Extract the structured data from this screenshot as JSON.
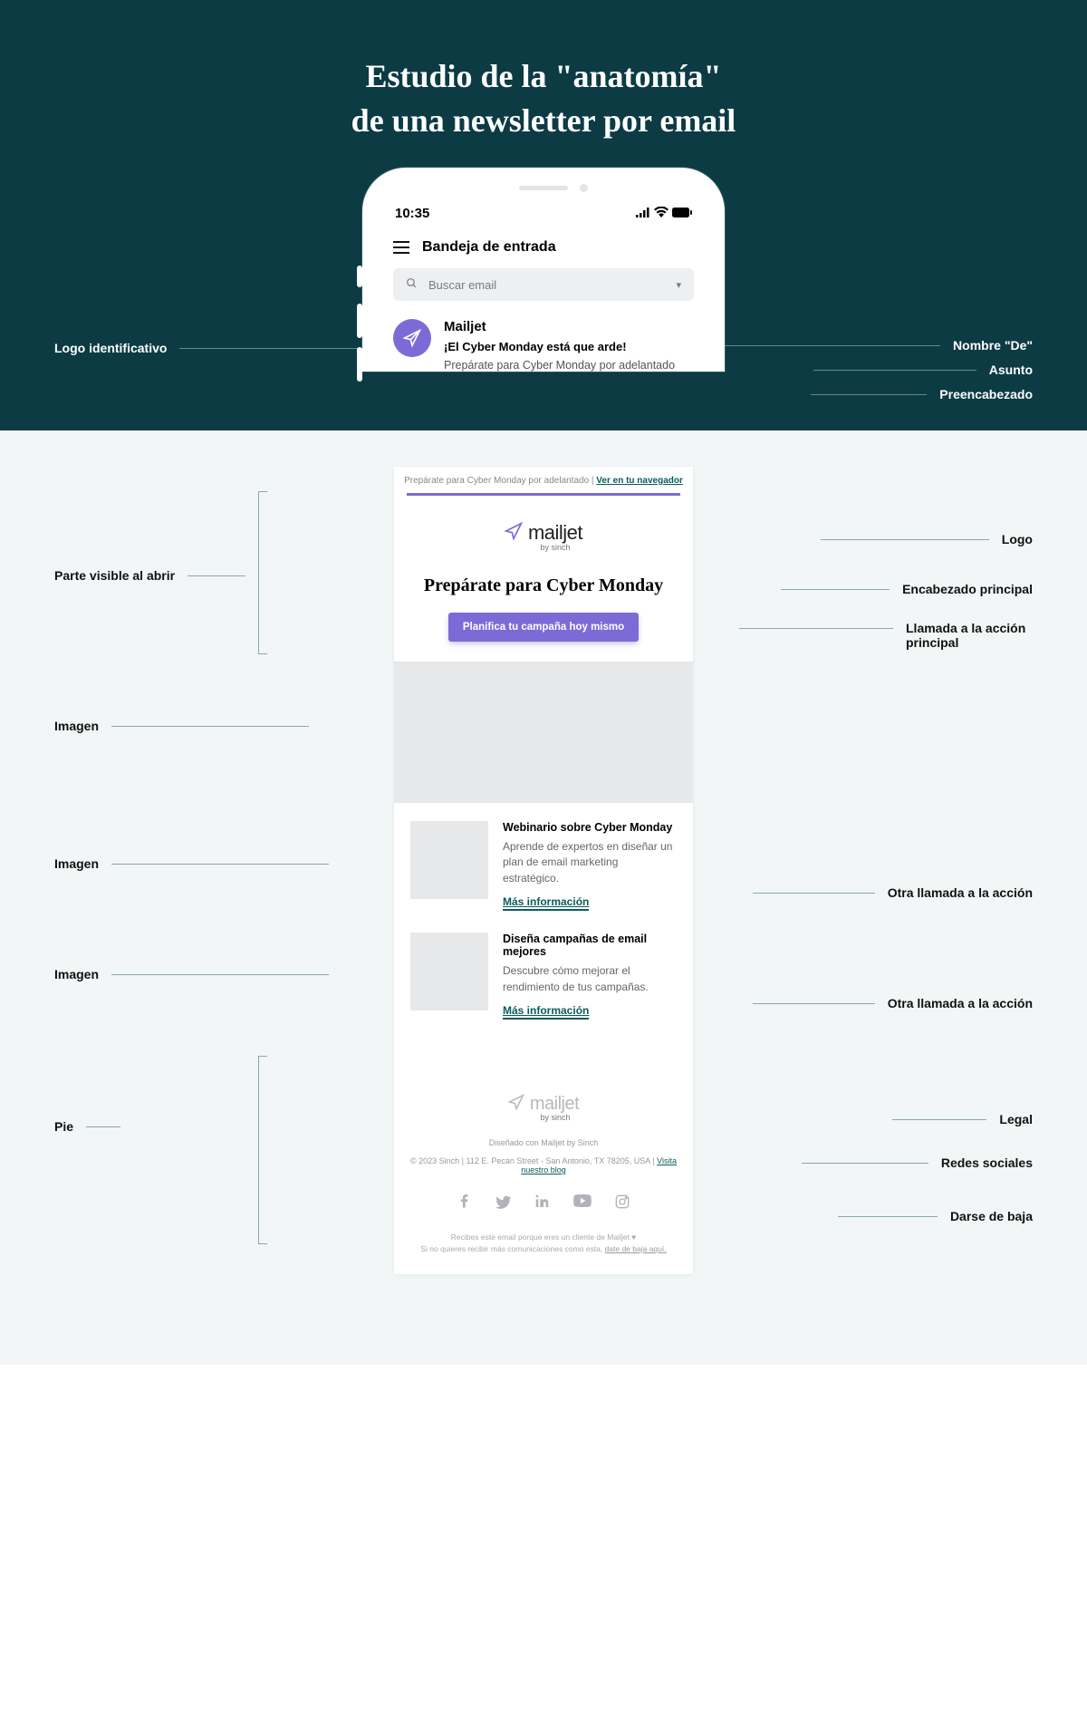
{
  "title_l1": "Estudio de la \"anatomía\"",
  "title_l2": "de una newsletter por email",
  "phone": {
    "time": "10:35",
    "inbox_title": "Bandeja de entrada",
    "search_placeholder": "Buscar email",
    "sender": "Mailjet",
    "subject": "¡El Cyber Monday está que arde!",
    "preheader": "Prepárate para Cyber Monday por adelantado"
  },
  "email": {
    "preheader_text": "Prepárate para Cyber Monday por adelantado  |  ",
    "view_browser": "Ver en tu navegador",
    "brand": "mailjet",
    "by": "by sinch",
    "headline": "Prepárate para Cyber Monday",
    "cta": "Planifica tu campaña hoy mismo",
    "row1": {
      "title": "Webinario sobre Cyber Monday",
      "body": "Aprende de expertos en diseñar un plan de email marketing estratégico.",
      "link": "Más información"
    },
    "row2": {
      "title": "Diseña campañas de email mejores",
      "body": "Descubre cómo mejorar el rendimiento de tus campañas.",
      "link": "Más información"
    },
    "footer": {
      "designed": "Diseñado con Mailjet by Sinch",
      "legal": "© 2023 Sinch | 112 E. Pecan Street - San Antonio, TX 78205, USA | ",
      "blog": "Visita nuestro blog",
      "tiny1": "Recibes este email porque eres un cliente de Mailjet ♥",
      "tiny2": "Si no quieres recibir más comunicaciones como esta, ",
      "unsubscribe": "date de baja aquí."
    }
  },
  "labels": {
    "logo_id": "Logo identificativo",
    "from": "Nombre \"De\"",
    "asunto": "Asunto",
    "prehead": "Preencabezado",
    "fold": "Parte visible al abrir",
    "logo": "Logo",
    "h1": "Encabezado principal",
    "cta_main": "Llamada a la acción principal",
    "imagen": "Imagen",
    "other_cta": "Otra llamada a la acción",
    "pie": "Pie",
    "legal": "Legal",
    "social": "Redes sociales",
    "unsub": "Darse de baja"
  }
}
